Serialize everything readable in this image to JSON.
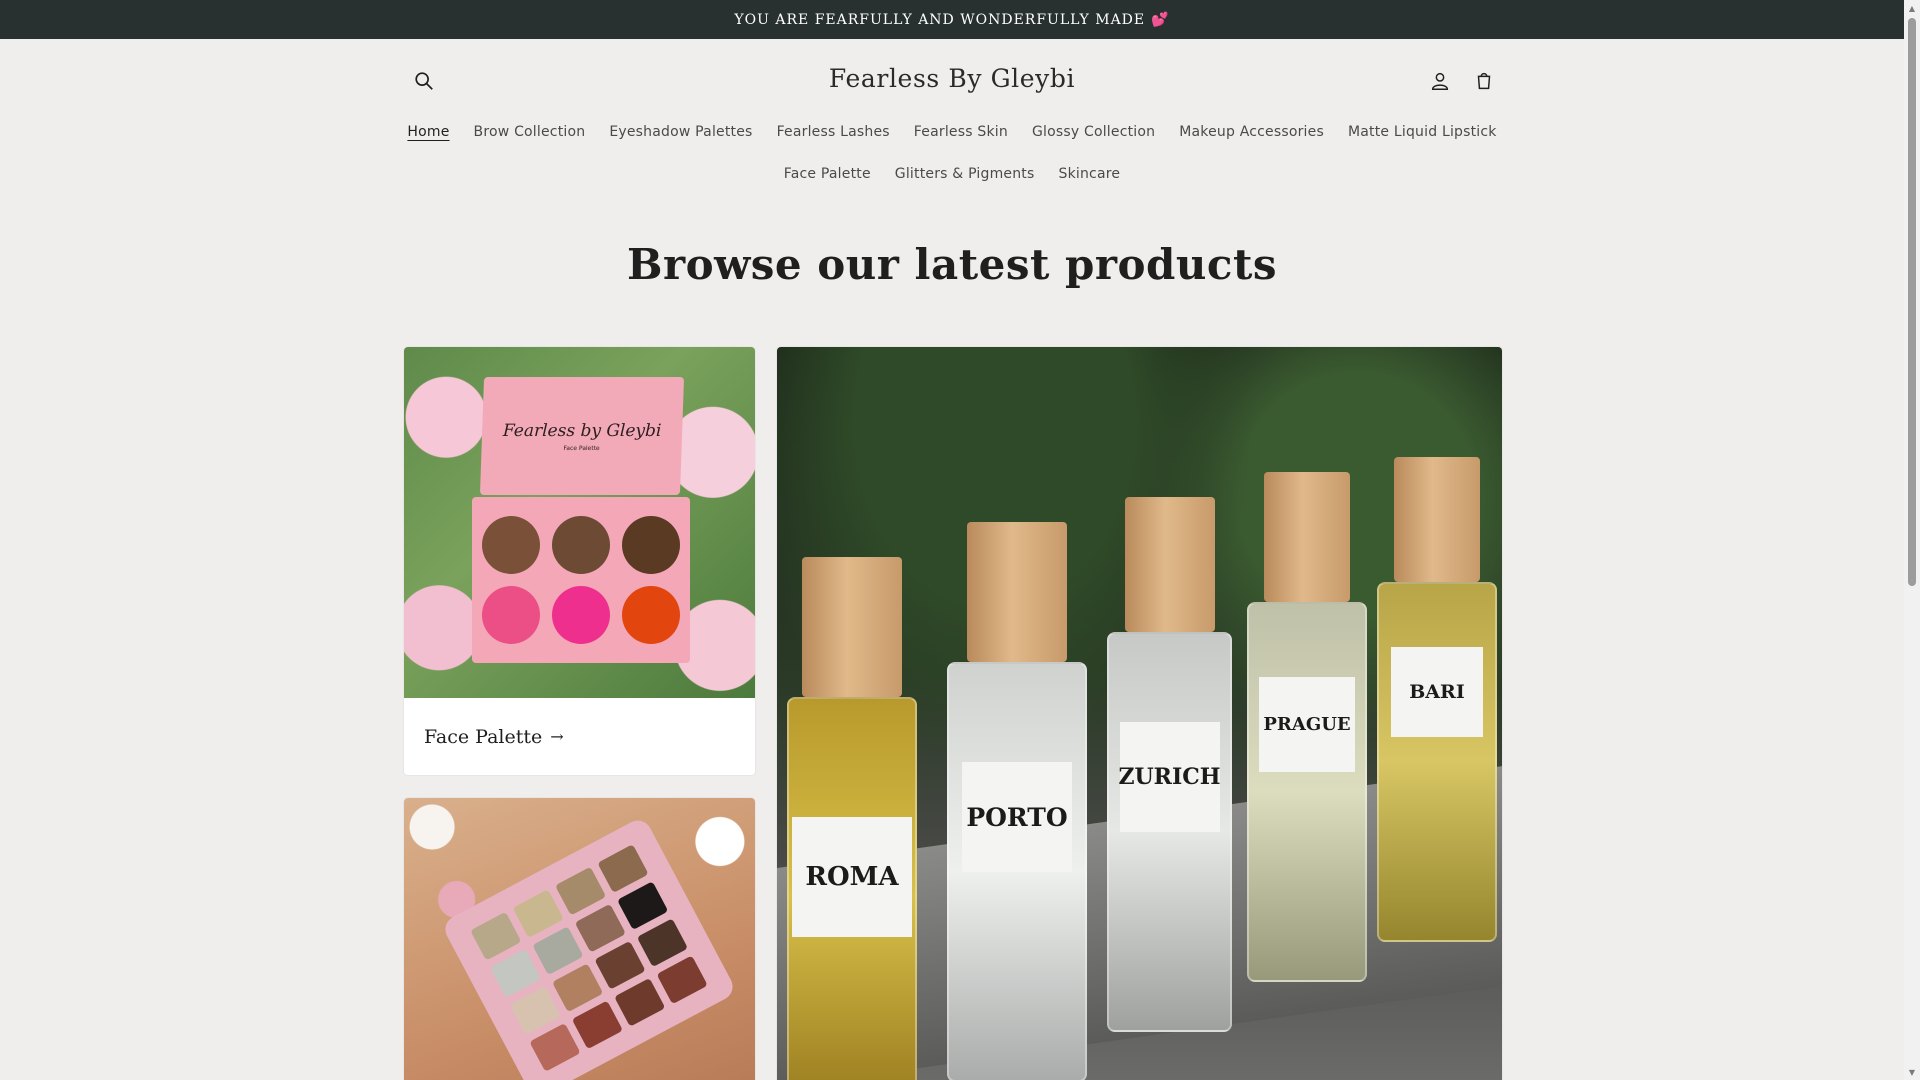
{
  "announcement": {
    "text": "YOU ARE FEARFULLY AND WONDERFULLY MADE",
    "emoji": "💕"
  },
  "header": {
    "logo": "Fearless By Gleybi",
    "icons": {
      "search": "search-icon",
      "account": "account-icon",
      "cart": "cart-icon"
    }
  },
  "nav": {
    "row1": [
      "Home",
      "Brow Collection",
      "Eyeshadow Palettes",
      "Fearless Lashes",
      "Fearless Skin",
      "Glossy Collection",
      "Makeup Accessories",
      "Matte Liquid Lipstick"
    ],
    "row2": [
      "Face Palette",
      "Glitters & Pigments",
      "Skincare"
    ],
    "active": "Home"
  },
  "main": {
    "heading": "Browse our latest products",
    "cards": [
      {
        "title": "Face Palette",
        "arrow": "→",
        "image_text": {
          "brand": "Fearless by Gleybi",
          "sub": "Face Palette"
        }
      }
    ],
    "perfumes": [
      "ROMA",
      "PORTO",
      "ZURICH",
      "PRAGUE",
      "BARI"
    ]
  },
  "colors": {
    "background": "#f0eeed",
    "announcement_bg": "#283030",
    "text": "#1f1f1f"
  }
}
